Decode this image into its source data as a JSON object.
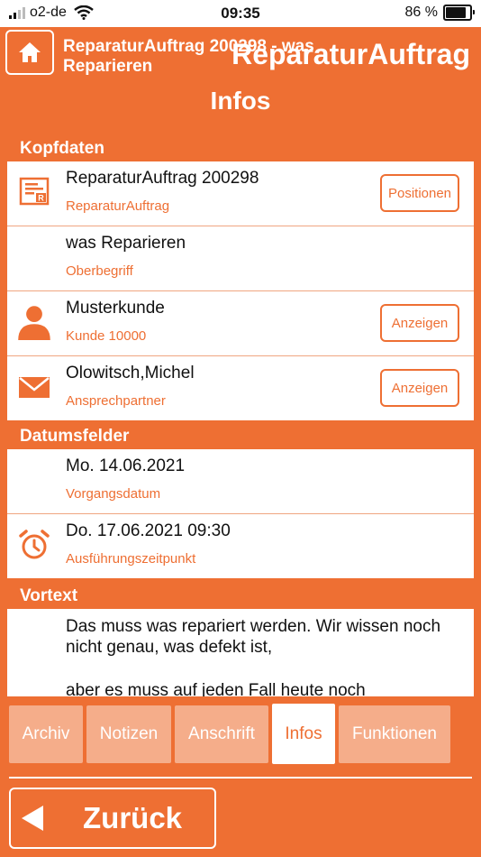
{
  "status_bar": {
    "carrier": "o2-de",
    "time": "09:35",
    "battery": "86 %",
    "battery_level": 0.86
  },
  "header": {
    "title": "ReparaturAuftrag 200298 - was Reparieren",
    "app_title": "ReparaturAuftrag",
    "home_icon": "home-icon"
  },
  "page_title": "Infos",
  "sections": {
    "kopfdaten": {
      "label": "Kopfdaten",
      "rows": [
        {
          "primary": "ReparaturAuftrag 200298",
          "secondary": "ReparaturAuftrag",
          "icon": "document-icon",
          "button": "Positionen"
        },
        {
          "primary": "was Reparieren",
          "secondary": "Oberbegriff"
        },
        {
          "primary": "Musterkunde",
          "secondary": "Kunde 10000",
          "icon": "person-icon",
          "button": "Anzeigen"
        },
        {
          "primary": "Olowitsch,Michel",
          "secondary": "Ansprechpartner",
          "icon": "mail-icon",
          "button": "Anzeigen"
        }
      ]
    },
    "datumsfelder": {
      "label": "Datumsfelder",
      "rows": [
        {
          "primary": "Mo. 14.06.2021",
          "secondary": "Vorgangsdatum"
        },
        {
          "primary": "Do. 17.06.2021 09:30",
          "secondary": "Ausführungszeitpunkt",
          "icon": "alarm-clock-icon"
        }
      ]
    },
    "vortext": {
      "label": "Vortext",
      "line1": "Das muss was repariert werden. Wir wissen noch nicht genau, was defekt ist,",
      "line2": "aber es muss auf jeden Fall heute noch"
    }
  },
  "tabs": [
    {
      "label": "Archiv",
      "active": false
    },
    {
      "label": "Notizen",
      "active": false
    },
    {
      "label": "Anschrift",
      "active": false
    },
    {
      "label": "Infos",
      "active": true
    },
    {
      "label": "Funktionen",
      "active": false
    }
  ],
  "back_button": {
    "label": "Zurück"
  },
  "colors": {
    "accent": "#ee6f33",
    "tab_inactive": "#f5ad8a",
    "card": "#ffffff"
  }
}
